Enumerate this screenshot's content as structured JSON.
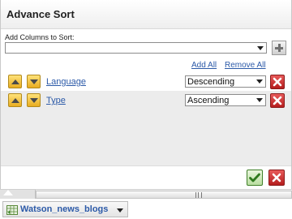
{
  "dialog": {
    "title": "Advance Sort",
    "add_columns_label": "Add Columns to Sort:",
    "add_all": "Add All",
    "remove_all": "Remove All"
  },
  "sort_rows": [
    {
      "column": "Language",
      "direction": "Descending"
    },
    {
      "column": "Type",
      "direction": "Ascending"
    }
  ],
  "icons": {
    "add": "plus-icon",
    "move_up": "arrow-up-icon",
    "move_down": "arrow-down-icon",
    "delete": "delete-x-icon",
    "ok": "checkmark-icon",
    "cancel": "close-x-icon",
    "sheet": "sheet-icon"
  },
  "sheet_tab": {
    "label": "Watson_news_blogs"
  },
  "colors": {
    "link": "#2c5aa8",
    "move_button": "#f2c440",
    "delete_button": "#cc2b2b",
    "ok_button": "#3f8f28"
  }
}
